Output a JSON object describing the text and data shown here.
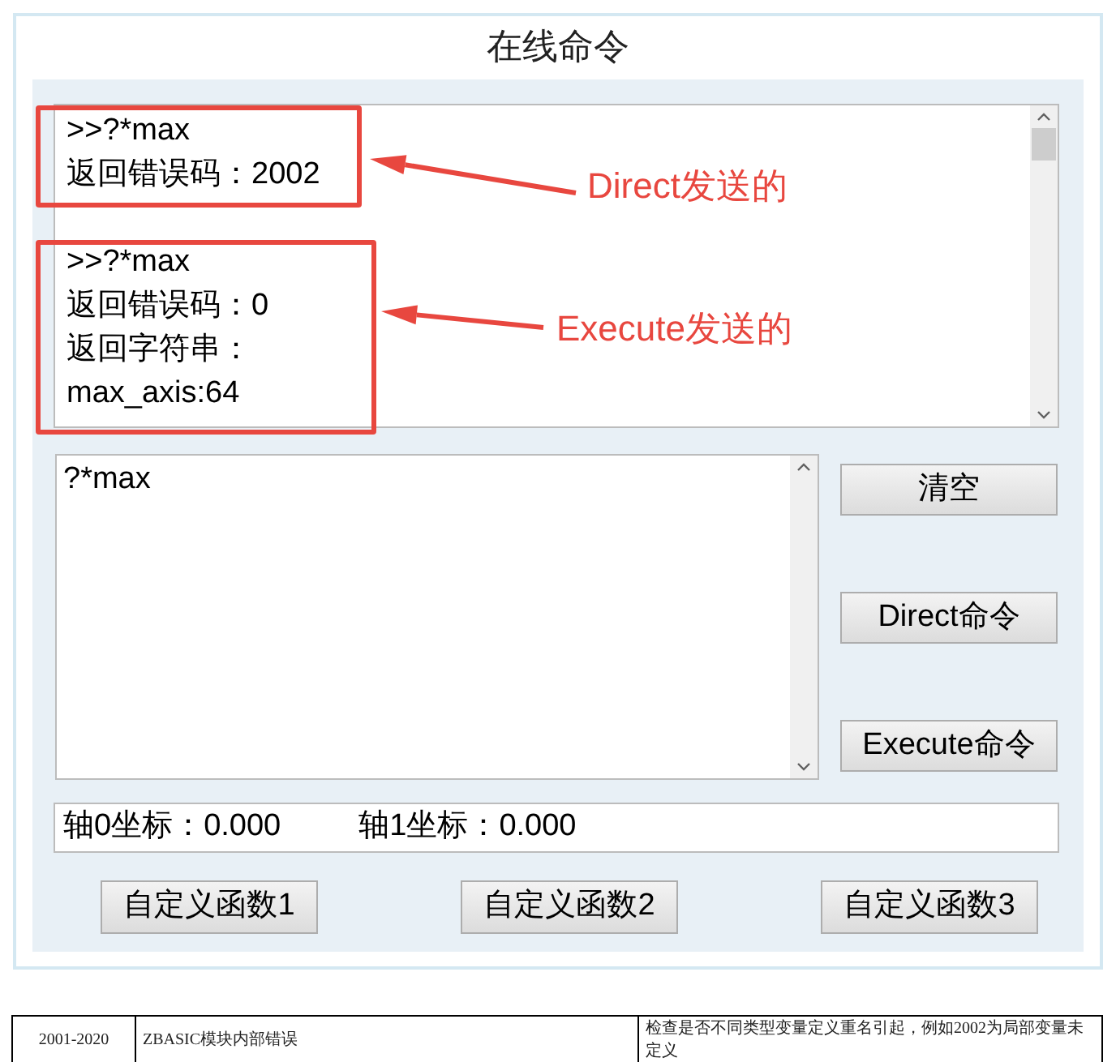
{
  "title": "在线命令",
  "output": {
    "groups": [
      {
        "lines": [
          ">>?*max",
          "返回错误码：2002"
        ],
        "annotation": "Direct发送的"
      },
      {
        "lines": [
          ">>?*max",
          "返回错误码：0",
          "返回字符串：",
          "max_axis:64"
        ],
        "annotation": "Execute发送的"
      }
    ]
  },
  "input": {
    "value": "?*max"
  },
  "buttons": [
    "清空",
    "Direct命令",
    "Execute命令"
  ],
  "status": {
    "axis0": "轴0坐标：0.000",
    "axis1": "轴1坐标：0.000"
  },
  "function_buttons": [
    "自定义函数1",
    "自定义函数2",
    "自定义函数3"
  ],
  "table": {
    "rows": [
      {
        "cells": [
          "2001-2020",
          "ZBASIC模块内部错误",
          "检查是否不同类型变量定义重名引起，例如2002为局部变量未定义"
        ]
      }
    ]
  }
}
